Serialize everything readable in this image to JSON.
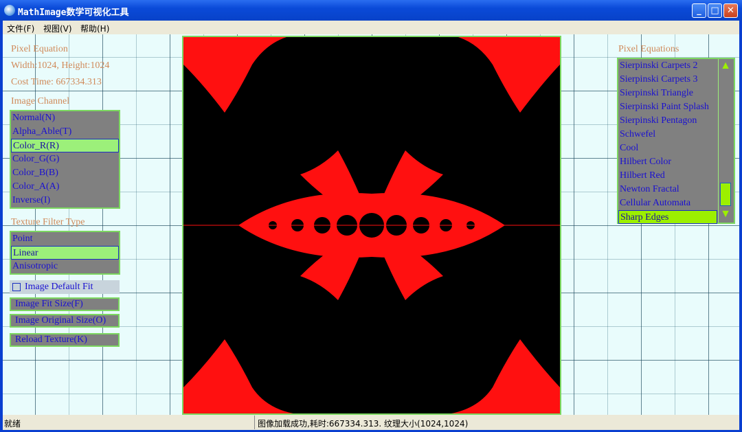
{
  "window": {
    "title": "MathImage数学可视化工具",
    "min": "_",
    "max": "□",
    "close": "✕"
  },
  "menu": [
    "文件(F)",
    "视图(V)",
    "帮助(H)"
  ],
  "info": {
    "heading": "Pixel Equation",
    "size": "Width:1024, Height:1024",
    "cost": "Cost Time: 667334.313"
  },
  "channel": {
    "label": "Image Channel",
    "items": [
      "Normal(N)",
      "Alpha_Able(T)",
      "Color_R(R)",
      "Color_G(G)",
      "Color_B(B)",
      "Color_A(A)",
      "Inverse(I)"
    ],
    "selected": "Color_R(R)"
  },
  "filter": {
    "label": "Texture Filter Type",
    "items": [
      "Point",
      "Linear",
      "Anisotropic"
    ],
    "selected": "Linear"
  },
  "default_fit": {
    "label": "Image Default Fit",
    "checked": false
  },
  "buttons": {
    "fit": "Image Fit Size(F)",
    "original": "Image Original Size(O)",
    "reload": "Reload Texture(K)"
  },
  "equations": {
    "label": "Pixel Equations",
    "items": [
      "Sierpinski Carpets 2",
      "Sierpinski Carpets 3",
      "Sierpinski Triangle",
      "Sierpinski Paint Splash",
      "Sierpinski Pentagon",
      "Schwefel",
      "Cool",
      "Hilbert Color",
      "Hilbert Red",
      "Newton Fractal",
      "Cellular Automata",
      "Sharp Edges"
    ],
    "selected": "Sharp Edges"
  },
  "status": {
    "left": "就绪",
    "right": "图像加载成功,耗时:667334.313. 纹理大小(1024,1024)"
  },
  "colors": {
    "fractal": "#ff1010",
    "highlight": "#9cf07a",
    "title_bar": "#0a4ad8"
  }
}
